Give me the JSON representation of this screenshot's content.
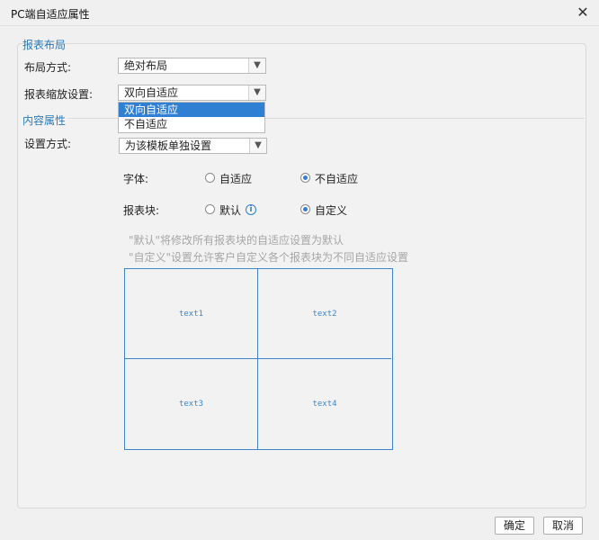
{
  "window": {
    "title": "PC端自适应属性",
    "close_symbol": "✕"
  },
  "layout_section": {
    "title": "报表布局",
    "layout_mode_label": "布局方式:",
    "layout_mode_value": "绝对布局",
    "zoom_label": "报表缩放设置:",
    "zoom_value": "双向自适应",
    "zoom_options": [
      "双向自适应",
      "不自适应"
    ],
    "zoom_selected_index": 0
  },
  "content_section": {
    "title": "内容属性",
    "setting_mode_label": "设置方式:",
    "setting_mode_value": "为该模板单独设置",
    "font_label": "字体:",
    "font_options": [
      "自适应",
      "不自适应"
    ],
    "font_checked_index": 1,
    "block_label": "报表块:",
    "block_options": [
      "默认",
      "自定义"
    ],
    "block_checked_index": 1,
    "info_icon_glyph": "i",
    "hint_lines": [
      "\"默认\"将修改所有报表块的自适应设置为默认",
      "\"自定义\"设置允许客户自定义各个报表块为不同自适应设置"
    ],
    "grid_cells": [
      "text1",
      "text2",
      "text3",
      "text4"
    ]
  },
  "footer": {
    "ok_label": "确定",
    "cancel_label": "取消"
  },
  "colors": {
    "accent": "#2f7fd3",
    "section_title": "#2a7ab8",
    "grid_border": "#3c86c8",
    "hint_text": "#a6a6a6"
  }
}
